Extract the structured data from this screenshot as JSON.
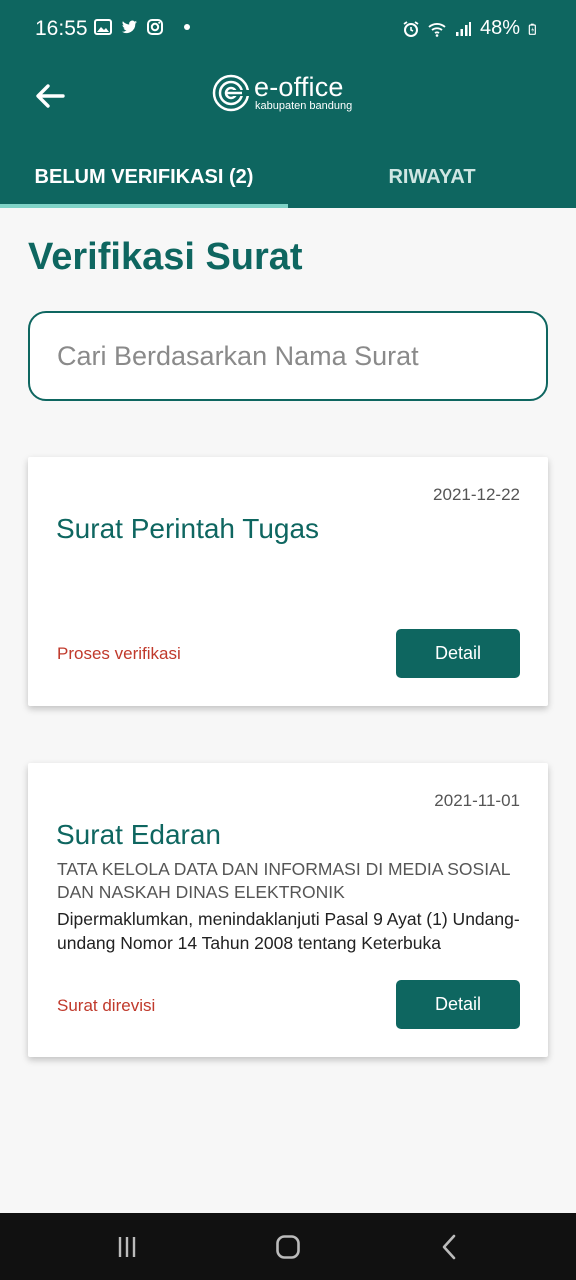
{
  "status_bar": {
    "time": "16:55",
    "battery": "48%",
    "left_icons": [
      "gallery-icon",
      "twitter-icon",
      "instagram-icon",
      "dot-icon"
    ],
    "right_icons": [
      "alarm-icon",
      "wifi-icon",
      "signal-icon",
      "battery-icon"
    ]
  },
  "header": {
    "logo_title": "e-office",
    "logo_subtitle": "kabupaten bandung",
    "back_icon": "back-arrow-icon"
  },
  "tabs": [
    {
      "label": "BELUM VERIFIKASI (2)",
      "active": true
    },
    {
      "label": "RIWAYAT",
      "active": false
    }
  ],
  "page_title": "Verifikasi Surat",
  "search": {
    "placeholder": "Cari Berdasarkan Nama Surat",
    "value": ""
  },
  "letters": [
    {
      "date": "2021-12-22",
      "title": "Surat Perintah Tugas",
      "subject": "",
      "description": "",
      "status": "Proses verifikasi",
      "button_label": "Detail"
    },
    {
      "date": "2021-11-01",
      "title": "Surat Edaran",
      "subject": "TATA KELOLA DATA DAN INFORMASI DI MEDIA SOSIAL DAN NASKAH DINAS ELEKTRONIK",
      "description": "Dipermaklumkan, menindaklanjuti Pasal 9 Ayat (1) Undang-undang Nomor 14 Tahun 2008 tentang Keterbuka",
      "status": "Surat direvisi",
      "button_label": "Detail"
    }
  ],
  "colors": {
    "primary": "#0e6660",
    "tab_indicator": "#7fd3c7",
    "status_text": "#c0392b",
    "background": "#f7f7f7"
  },
  "system_nav": [
    "recent-apps-icon",
    "home-icon",
    "back-icon"
  ]
}
